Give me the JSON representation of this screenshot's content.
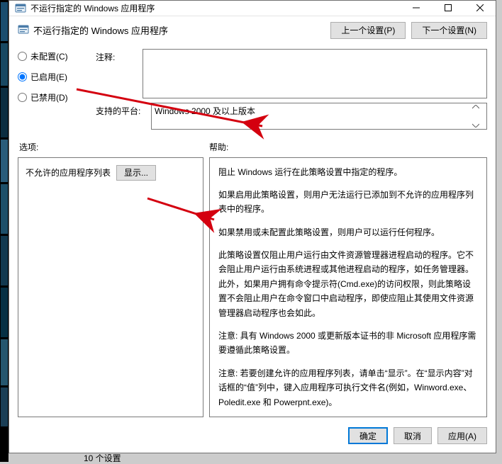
{
  "window": {
    "title": "不运行指定的 Windows 应用程序"
  },
  "subtitle": "不运行指定的 Windows 应用程序",
  "nav": {
    "prev": "上一个设置(P)",
    "next": "下一个设置(N)"
  },
  "radios": {
    "not_configured": "未配置(C)",
    "enabled": "已启用(E)",
    "disabled": "已禁用(D)",
    "selected": "enabled"
  },
  "comment": {
    "label": "注释:",
    "value": ""
  },
  "platform": {
    "label": "支持的平台:",
    "value": "Windows 2000 及以上版本"
  },
  "pane_titles": {
    "options": "选项:",
    "help": "帮助:"
  },
  "options": {
    "disallow_list_label": "不允许的应用程序列表",
    "show_button": "显示..."
  },
  "help": {
    "p1": "阻止 Windows 运行在此策略设置中指定的程序。",
    "p2": "如果启用此策略设置，则用户无法运行已添加到不允许的应用程序列表中的程序。",
    "p3": "如果禁用或未配置此策略设置，则用户可以运行任何程序。",
    "p4": "此策略设置仅阻止用户运行由文件资源管理器进程启动的程序。它不会阻止用户运行由系统进程或其他进程启动的程序，如任务管理器。 此外，如果用户拥有命令提示符(Cmd.exe)的访问权限，则此策略设置不会阻止用户在命令窗口中启动程序，即使应阻止其使用文件资源管理器启动程序也会如此。",
    "p5": "注意: 具有 Windows 2000 或更新版本证书的非 Microsoft 应用程序需要遵循此策略设置。",
    "p6": "注意: 若要创建允许的应用程序列表，请单击“显示”。在“显示内容”对话框的“值”列中，键入应用程序可执行文件名(例如，Winword.exe、Poledit.exe 和 Powerpnt.exe)。"
  },
  "footer": {
    "ok": "确定",
    "cancel": "取消",
    "apply": "应用(A)"
  },
  "bg_text": "10 个设置"
}
